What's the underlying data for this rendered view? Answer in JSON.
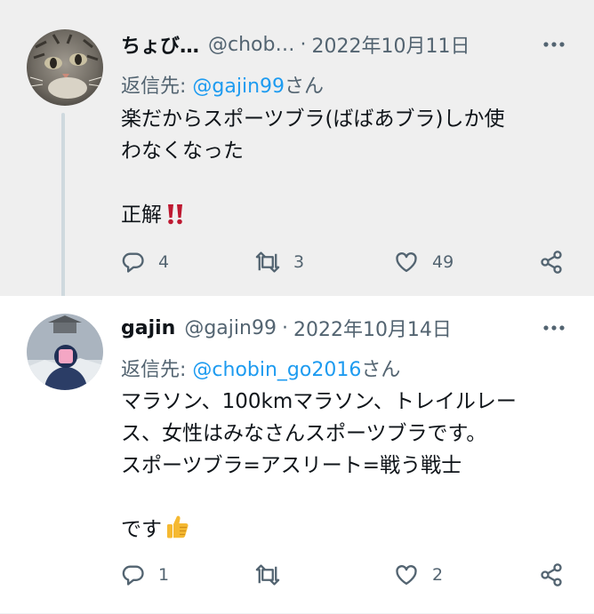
{
  "tweets": [
    {
      "display_name": "ちょび…",
      "handle": "@chob…",
      "separator": "·",
      "date": "2022年10月11日",
      "reply_label": "返信先: ",
      "reply_handle": "@gajin99",
      "reply_suffix": "さん",
      "body_lines": [
        "楽だからスポーツブラ(ばばあブラ)しか使",
        "わなくなった",
        "",
        "正解"
      ],
      "emoji_icon": "double-exclamation-icon",
      "reply_count": "4",
      "retweet_count": "3",
      "like_count": "49"
    },
    {
      "display_name": "gajin",
      "handle": "@gajin99",
      "separator": "·",
      "date": "2022年10月14日",
      "reply_label": "返信先: ",
      "reply_handle": "@chobin_go2016",
      "reply_suffix": "さん",
      "body_lines": [
        "マラソン、100kmマラソン、トレイルレー",
        "ス、女性はみなさんスポーツブラです。",
        "スポーツブラ=アスリート=戦う戦士",
        "",
        "です"
      ],
      "emoji_icon": "thumbs-up-icon",
      "reply_count": "1",
      "retweet_count": "",
      "like_count": "2"
    }
  ],
  "colors": {
    "link": "#1d9bf0",
    "secondary_text": "#536471",
    "highlight_background": "#efefef",
    "thread_line": "#cfd9de"
  },
  "icons": [
    "more-icon",
    "reply-icon",
    "retweet-icon",
    "like-icon",
    "share-icon"
  ]
}
